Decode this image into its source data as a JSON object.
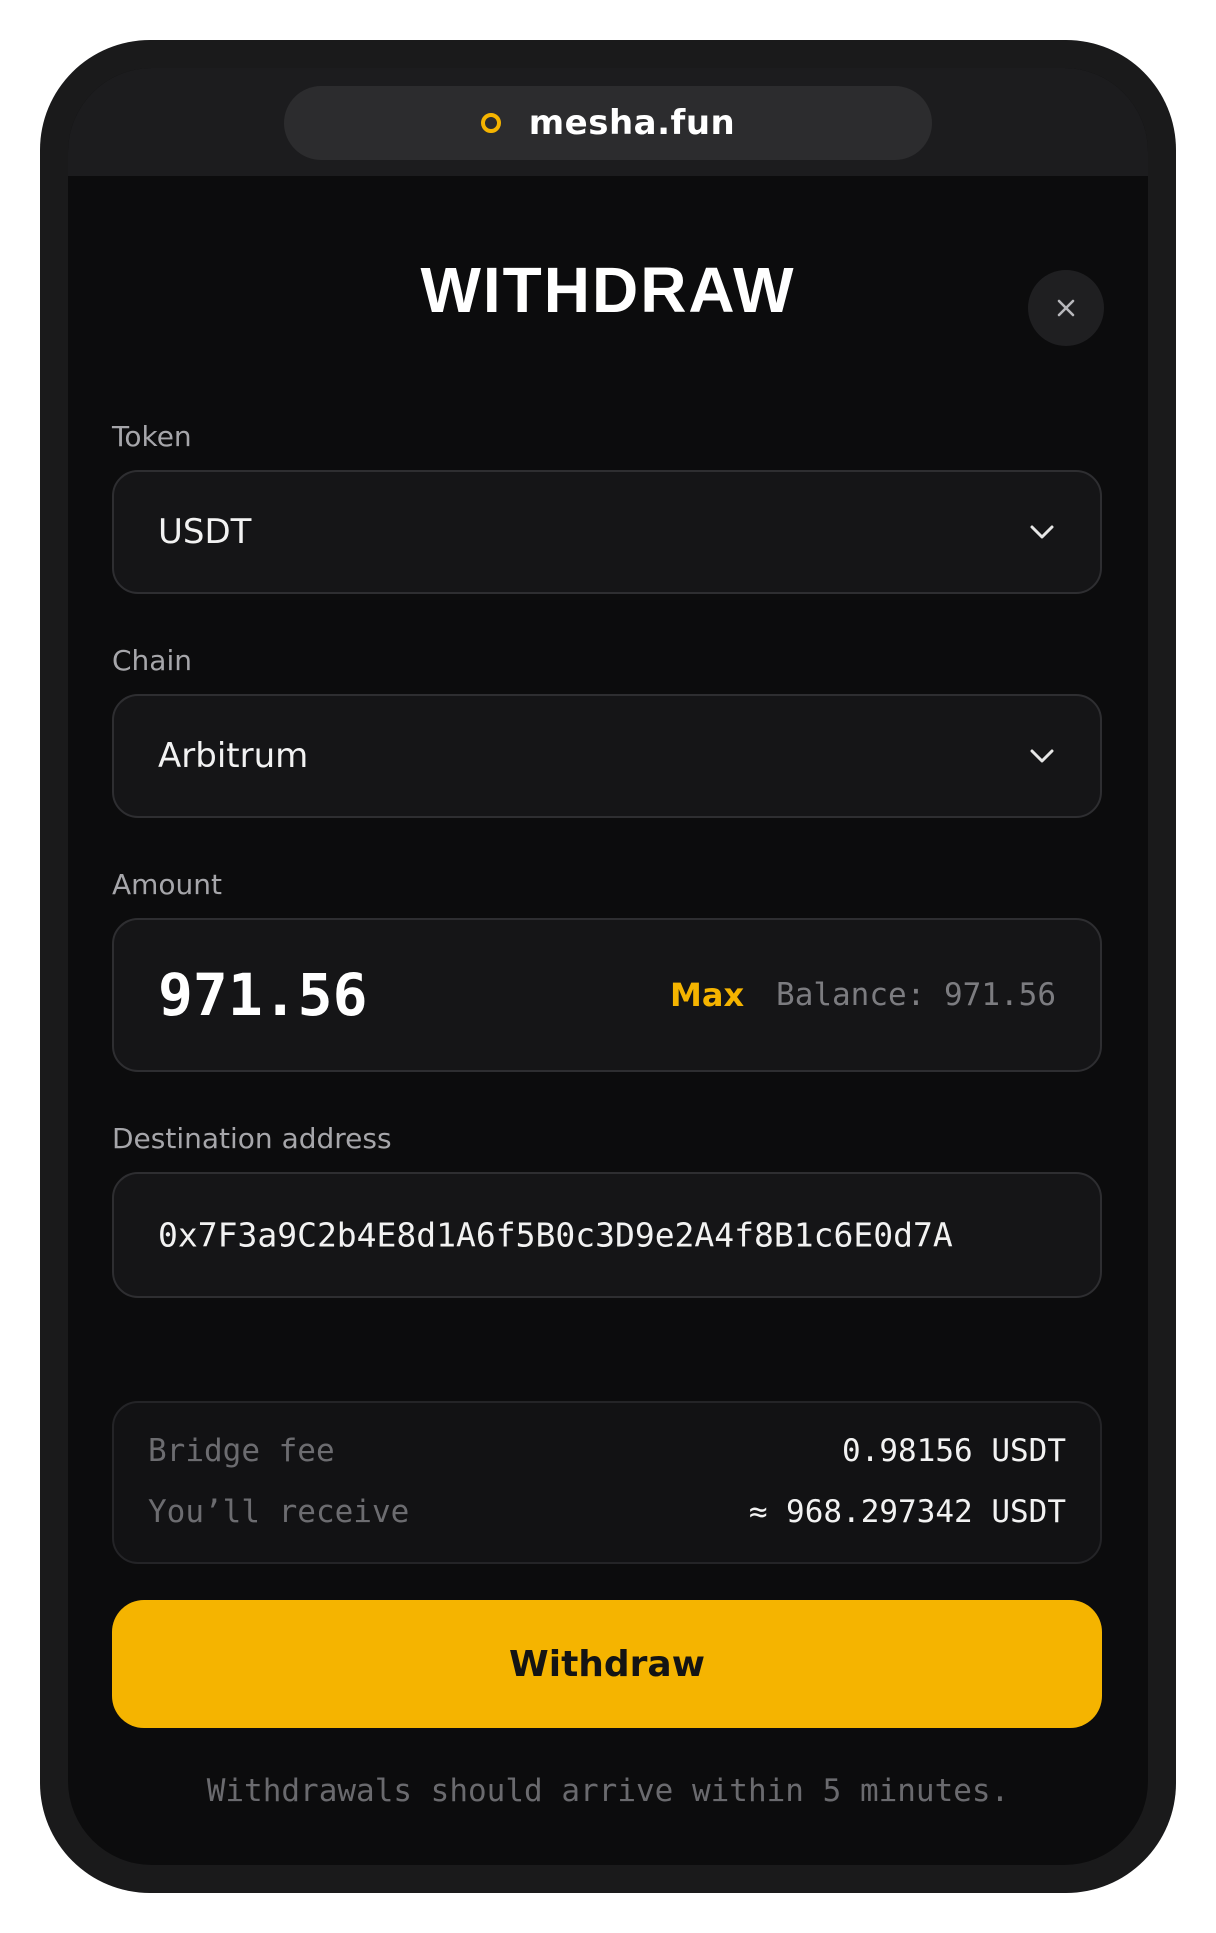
{
  "browser": {
    "url": "mesha.fun",
    "status_icon": "circle-icon",
    "accent_color": "#f5b400"
  },
  "modal": {
    "title": "WITHDRAW",
    "close_icon": "close-icon"
  },
  "token": {
    "label": "Token",
    "value": "USDT"
  },
  "chain": {
    "label": "Chain",
    "value": "Arbitrum"
  },
  "amount": {
    "label": "Amount",
    "value": "971.56",
    "max_label": "Max",
    "balance_text": "Balance: 971.56"
  },
  "destination": {
    "label": "Destination address",
    "value": "0x7F3a9C2b4E8d1A6f5B0c3D9e2A4f8B1c6E0d7A"
  },
  "summary": {
    "bridge_fee_label": "Bridge fee",
    "bridge_fee_value": "0.98156 USDT",
    "receive_label": "You’ll receive",
    "receive_value": "≈ 968.297342 USDT"
  },
  "actions": {
    "withdraw_label": "Withdraw",
    "button_color": "#f5b400"
  },
  "footnote": "Withdrawals should arrive within 5 minutes."
}
